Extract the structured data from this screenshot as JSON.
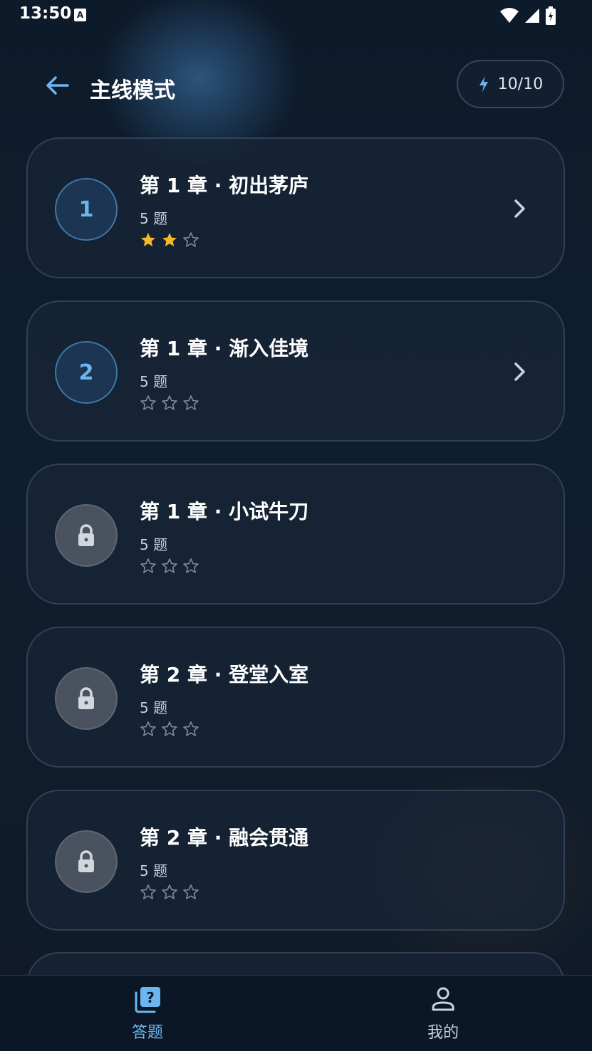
{
  "status_bar": {
    "time": "13:50",
    "a_badge": "A"
  },
  "header": {
    "title": "主线模式",
    "energy": "10/10"
  },
  "chapters": [
    {
      "title": "第 1 章 · 初出茅庐",
      "count": "5 题",
      "badge": "1",
      "locked": false,
      "stars": 2
    },
    {
      "title": "第 1 章 · 渐入佳境",
      "count": "5 题",
      "badge": "2",
      "locked": false,
      "stars": 0
    },
    {
      "title": "第 1 章 · 小试牛刀",
      "count": "5 题",
      "badge": "",
      "locked": true,
      "stars": 0
    },
    {
      "title": "第 2 章 · 登堂入室",
      "count": "5 题",
      "badge": "",
      "locked": true,
      "stars": 0
    },
    {
      "title": "第 2 章 · 融会贯通",
      "count": "5 题",
      "badge": "",
      "locked": true,
      "stars": 0
    }
  ],
  "nav": {
    "quiz_label": "答题",
    "mine_label": "我的"
  },
  "colors": {
    "accent": "#6cb6f0",
    "star_filled": "#f5b92a",
    "star_empty": "#7d8a99",
    "background": "#0f1e2f"
  },
  "icons": [
    "back-arrow-icon",
    "lightning-icon",
    "lock-icon",
    "chevron-right-icon",
    "star-icon",
    "quiz-icon",
    "person-icon",
    "wifi-icon",
    "signal-icon",
    "battery-icon"
  ]
}
